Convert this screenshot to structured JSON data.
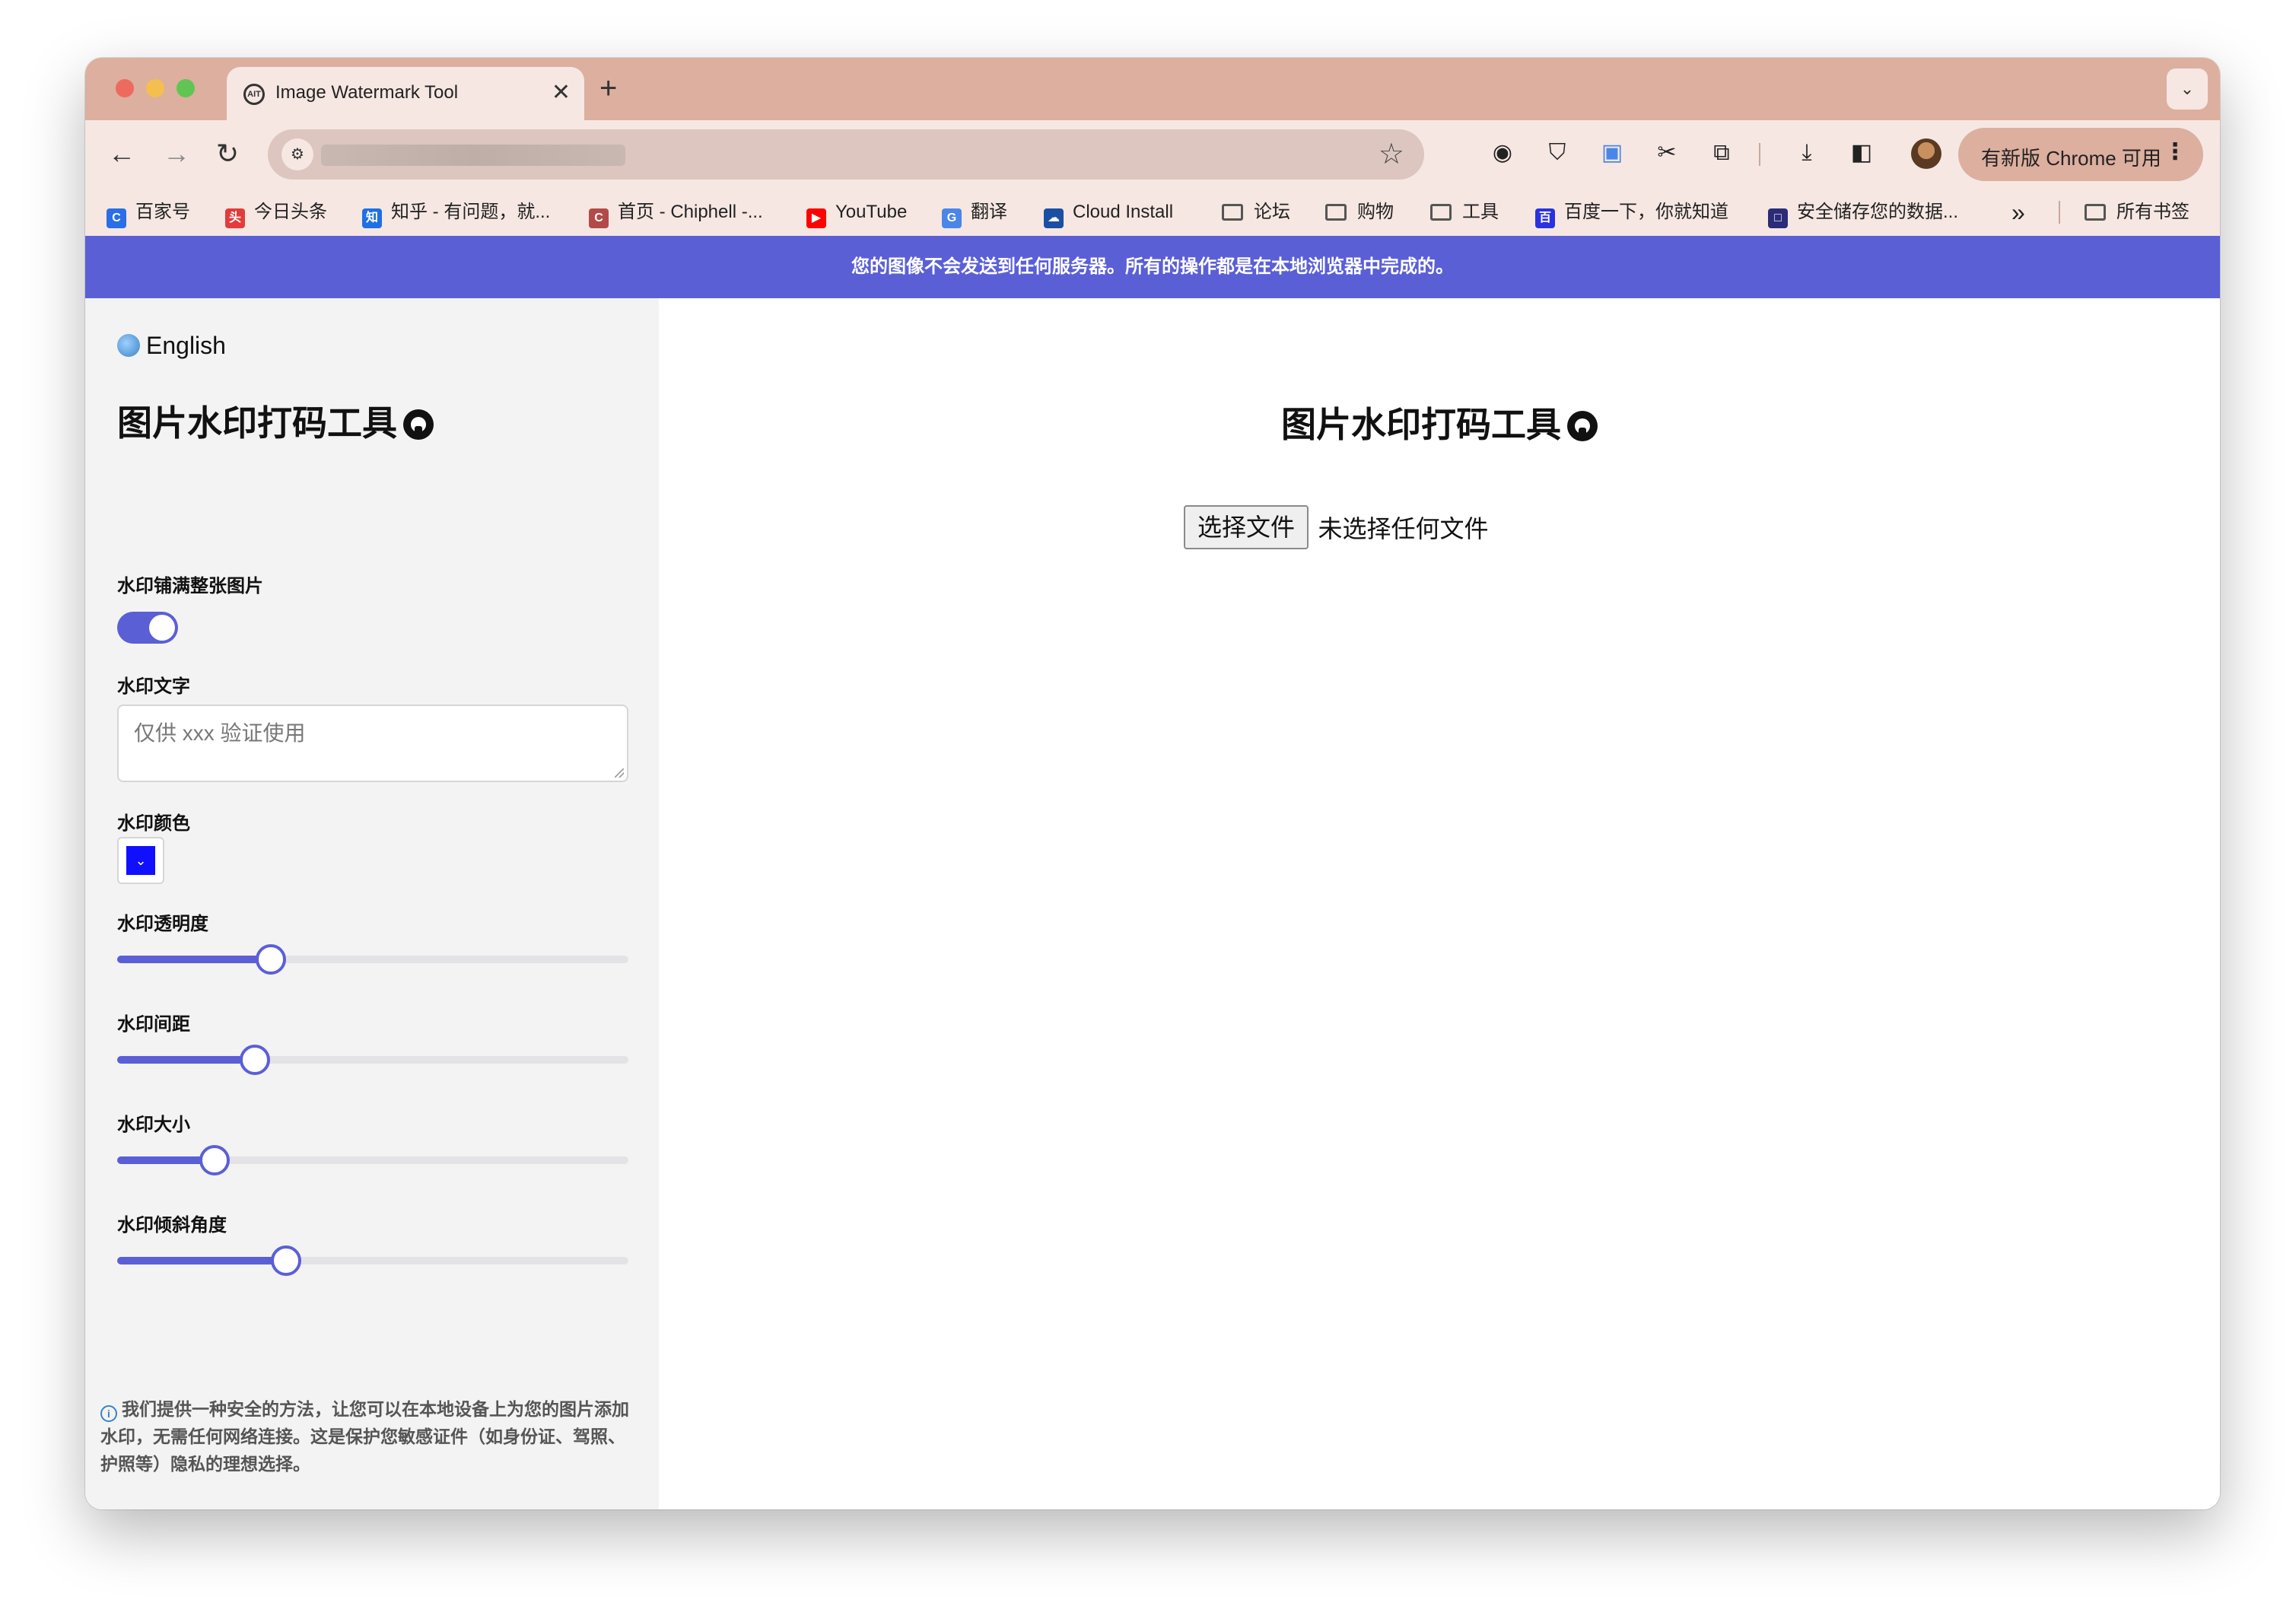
{
  "browser": {
    "tab_title": "Image Watermark Tool",
    "tab_icon_text": "AIT",
    "close_glyph": "✕",
    "new_tab_glyph": "+",
    "tabs_menu_glyph": "⌄",
    "update_label": "有新版 Chrome 可用",
    "update_menu_glyph": "⋮",
    "nav": {
      "back": "←",
      "forward": "→",
      "reload": "↻"
    },
    "toolbar_icons": [
      "tab-search-icon",
      "bitwarden-icon",
      "translate-extension-icon",
      "screenshot-icon",
      "extensions-icon",
      "download-icon",
      "side-panel-icon"
    ]
  },
  "bookmarks": {
    "items": [
      {
        "label": "百家号",
        "icon_color": "#2a6ee8",
        "icon_text": "C"
      },
      {
        "label": "今日头条",
        "icon_color": "#e33b3b",
        "icon_text": "头"
      },
      {
        "label": "知乎 - 有问题，就...",
        "icon_color": "#1f6fe5",
        "icon_text": "知"
      },
      {
        "label": "首页 - Chiphell -...",
        "icon_color": "#b34a4a",
        "icon_text": "C"
      },
      {
        "label": "YouTube",
        "icon_color": "#ff0000",
        "icon_text": "▶"
      },
      {
        "label": "翻译",
        "icon_color": "#4a86e8",
        "icon_text": "G"
      },
      {
        "label": "Cloud Install",
        "icon_color": "#1a4fa3",
        "icon_text": "☁"
      },
      {
        "label": "论坛",
        "folder": true
      },
      {
        "label": "购物",
        "folder": true
      },
      {
        "label": "工具",
        "folder": true
      },
      {
        "label": "百度一下，你就知道",
        "icon_color": "#2932e1",
        "icon_text": "百"
      },
      {
        "label": "安全储存您的数据...",
        "icon_color": "#2b2b7a",
        "icon_text": "□"
      }
    ],
    "overflow_glyph": "»",
    "all_bookmarks": "所有书签"
  },
  "banner": {
    "text": "您的图像不会发送到任何服务器。所有的操作都是在本地浏览器中完成的。"
  },
  "sidebar": {
    "language": "English",
    "title": "图片水印打码工具",
    "tile_label": "水印铺满整张图片",
    "tile_enabled": true,
    "text_label": "水印文字",
    "text_placeholder": "仅供 xxx 验证使用",
    "color_label": "水印颜色",
    "color_value": "#1010ff",
    "color_glyph": "⌄",
    "opacity_label": "水印透明度",
    "opacity_value": 0.3,
    "spacing_label": "水印间距",
    "spacing_value": 0.27,
    "size_label": "水印大小",
    "size_value": 0.19,
    "angle_label": "水印倾斜角度",
    "angle_value": 0.33,
    "info_icon": "i",
    "info_text": "我们提供一种安全的方法，让您可以在本地设备上为您的图片添加水印，无需任何网络连接。这是保护您敏感证件（如身份证、驾照、护照等）隐私的理想选择。"
  },
  "main": {
    "title": "图片水印打码工具",
    "file_button": "选择文件",
    "file_status": "未选择任何文件"
  },
  "colors": {
    "accent": "#5b5fd6",
    "tabstrip": "#dcaf9f",
    "toolbar": "#f6e7e2"
  }
}
